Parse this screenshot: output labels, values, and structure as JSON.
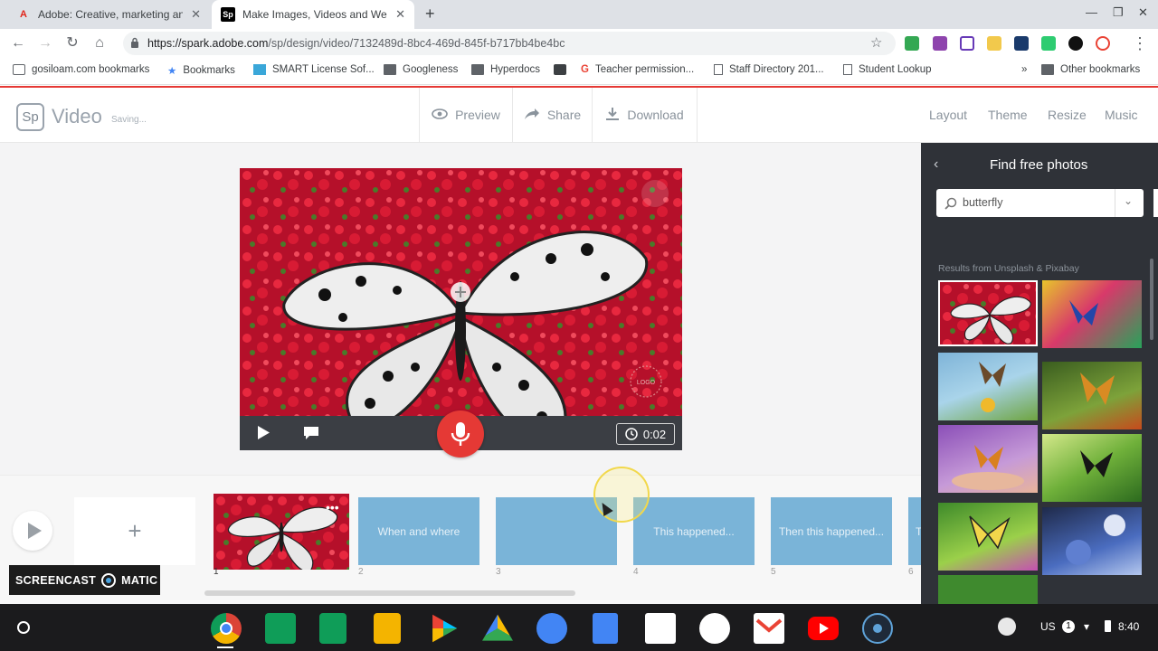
{
  "browser": {
    "tabs": [
      {
        "title": "Adobe: Creative, marketing and"
      },
      {
        "title": "Make Images, Videos and Web S"
      }
    ],
    "url_host": "https://spark.adobe.com",
    "url_path": "/sp/design/video/7132489d-8bc4-469d-845f-b717bb4be4bc",
    "bookmarks": [
      "gosiloam.com bookmarks",
      "Bookmarks",
      "SMART License Sof...",
      "Googleness",
      "Hyperdocs",
      "Teacher permission...",
      "Staff Directory 201...",
      "Student Lookup"
    ],
    "other_bookmarks": "Other bookmarks",
    "overflow": "»"
  },
  "app": {
    "logo": "Sp",
    "title": "Video",
    "status": "Saving...",
    "actions": {
      "preview": "Preview",
      "share": "Share",
      "download": "Download"
    },
    "menu": {
      "layout": "Layout",
      "theme": "Theme",
      "resize": "Resize",
      "music": "Music"
    }
  },
  "player": {
    "time": "0:02",
    "logo_watermark": "LOGO"
  },
  "timeline": {
    "add": "+",
    "slides": [
      {
        "number": "1",
        "label": ""
      },
      {
        "number": "2",
        "label": "When and where"
      },
      {
        "number": "3",
        "label": ""
      },
      {
        "number": "4",
        "label": "This happened..."
      },
      {
        "number": "5",
        "label": "Then this happened..."
      },
      {
        "number": "6",
        "label": "T"
      }
    ]
  },
  "panel": {
    "title": "Find free photos",
    "search_value": "butterfly",
    "results_label": "Results from Unsplash & Pixabay"
  },
  "recorder": {
    "label": "SCREENCAST",
    "brand": "MATIC"
  },
  "taskbar": {
    "locale": "US",
    "badge": "1",
    "time": "8:40"
  },
  "colors": {
    "accent_red": "#e53935",
    "slide_blue": "#7ab4d8",
    "panel_bg": "#2f3238"
  }
}
